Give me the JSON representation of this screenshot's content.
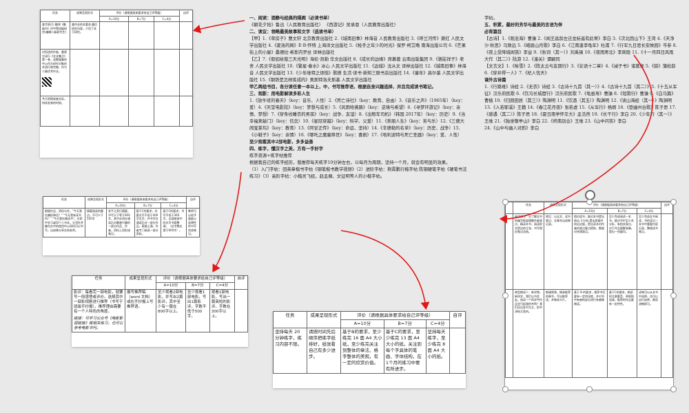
{
  "rubric_small": {
    "h_task": "任务",
    "h_form": "成果呈现形式",
    "h_eval": "评价（请根据具体要求给自己评等级）",
    "h_a": "A=10分",
    "h_b": "B=7分",
    "h_c": "C=4分",
    "h_self": "自评",
    "rows": [
      [
        "查字纸(1) 翻译《剿敌书》评中等班级研究(编辑二级研究生)",
        "查作业的本要求,最后研究内容，介绍了关于研究。"
      ],
      [
        "对所选的作者、重视它读行《文化集注》第一卷，读数据集的中心作为研究对象的并进行和完善，作为二级优秀作业。"
      ],
      [
        "共大地理或者交际，持续发育的时刻。"
      ]
    ]
  },
  "rubric_mid": {
    "h_task": "任务",
    "h_form": "成果呈现形式",
    "h_eval": "评价（请根据具体要求给自己评等级）",
    "h_a": "A=10分",
    "h_b": "B=7分",
    "h_c": "C=4分",
    "h_self": "自评",
    "task": "根据作品、资料与作，\"今天我在编织神话？\" \"今天我有读书吗？\" \"今天我在精读书\"，在家中学习或用个人书本，头顶在并编号在中的使用中心同时可以书写。出成果分享交给老师。",
    "form": "摘要阅读的重点，不可少于500字",
    "a": "发手之家行摘要，书写大于等于600字，其中必须在诵读后对最感兴趣的一部分作品、作者，资料上用形成笔记。",
    "b": "基于C的要求，对要点写不低于400字文字，并书写在诵读后对一部分作品，表格之诵，作者专门阅读一部分资料。",
    "c": "基于C的要求，书写不低于300字，全部按说中的文字书面整理，（总字数应提于600字）。",
    "self": "教师可以给予鼓励以选择性的书写完成笔记。"
  },
  "rubric_left": {
    "h_task": "任务",
    "h_form": "成果呈现形式",
    "h_eval": "评价（请根据具体要求给自己评等级）",
    "h_a": "A=10分",
    "h_b": "B=7分",
    "h_c": "C=4分",
    "h_self": "自评",
    "task": "影评：每看完一部电影，就要写一段感悟或评价。选择其中一部影视剧进行推荐（书写于班级手抄报），推荐理由需要有一个人特色的角度。",
    "task2": "链接：可学习公众号《电影影视链接》做相关练习，也可以参考电影书刊。",
    "form": "撰写推荐稿（word 文档）或在手抄报上写推荐语。",
    "a": "至少观看2部电影，并写出2篇影评，其中至少有一篇在800字以上。",
    "b": "至少观看1部电影，写出1篇影评，字数不低于500字。",
    "c": "观看1部电影，写出一篇简短的影评，字数在300字以上。"
  },
  "rubric_bottom": {
    "h_task": "任务",
    "h_form": "成果呈现形式",
    "h_eval": "评价（请根据具体要求给自己评等级）",
    "h_a": "A=10分",
    "h_b": "B=7分",
    "h_c": "C=4分",
    "h_self": "自评",
    "task": "坚持每天 20 分钟练字，练习内容不限。",
    "form": "请按时间先后顺序把练字纸排好，纸张看自己有多少进步。",
    "a": "基于B的要求，至少练完 16 面 A4 大小纸，至少练完关注到整体的章法、格字整体的美观，有一定的欣赏价值。",
    "b": "基于C的要求，至少练完 13 面 A4 大小的纸，关注到每个字具体的笔画、字体结构，在1个月的练习中要有所进步。",
    "c": "坚持每天练字，至少练完 8 面 A4 大小的纸。"
  },
  "rubric_right": {
    "h_task": "任务",
    "h_form": "成果呈现形式",
    "h_eval": "评价（请根据具体要求给自己评等级）",
    "h_a": "A=10分",
    "h_b": "B=7分",
    "h_c": "C=4分",
    "h_self": "自评",
    "r1_task": "阅读前作：对了解全书的编写框架理解作者观点，精读本书，阅读前文提出的主张，书写相应笔记总结。",
    "r1_form": "除后：以论文、读书笔记、文章合出成果记录。",
    "r1_a": "相对读书，能对本书提出结论,于分析,提出质疑并给出论据，提出读本对作者的观点要点提炼，数据对合理观点。",
    "r1_b": "至少完成阅读一本书，能对书中至少合分析，有相关观点，对于作品理解准确，提出一些疑问。",
    "r1_c": "至少完成全书阅读，书的读记一本书中重要内容记录，整理读书笔记。",
    "r2_task": "典型朗读人：新学期，新同学，我们以书会友。阅读一个同学中作品会引起我的共鸣？我们应出发书为主，把书讲给大家听。",
    "r2_form": "朗诵视频，摘录推荐的章节，写出推荐语，并做成卡片。",
    "r2_a": "基于 B 的要求，推荐书目要有一定的深度，并对书中有感的部分进行有感情朗读。",
    "r2_b": "基于C的要求，朗读时注意重音、停顿和语调，推荐的作品要有一定特色。",
    "r2_c": "读物可以从本书中选择，也可以自行选择，朗读流畅即可。"
  },
  "doc_center": {
    "s1": "一、阅读：酒静与经典的隔阂（必读书单）",
    "s1a": "《朝花夕拾》鲁迅（人民教育出版社） 《西游记》吴承恩（人民教育出版社）",
    "s2": "二、读议：领略最美故事和文字（选读书单）",
    "s2a": "【甲】1.《草房子》曹文轩 北京教育出版社 2.《城南旧事》林海音 人民教育出版社 3.《呼兰河传》萧红 人民文学出版社 4.《夏洛的网》E·B·怀特 上海译文出版社 5.《枪手之年少的时光》保罗·柯艾略 南海出版公司 6.《芒果街上的小屋》桑德拉·希斯内罗丝 译林出版社",
    "s2b": "【乙】7.《假如给我三天光明》海伦·凯勒 华文出版社 8.《成长的边缘》席慕蓉 云南出版集团 9.《骆驼祥子》老舍 人民文学出版社 10.《繁星·春水》冰心 人民文学出版社 11.《边城》沈从文 译林出版社 12.《城南旧事》林海音 人民文学出版社 13.《少年维特之烦恼》歌德 生活·读书·新知三联书店出版社 14.《童年》高尔基 人民文学出版社 15.《钢铁是怎样炼成的》奥斯特洛夫斯基 人民文学出版社",
    "s2c": "甲乙两组书目，各分读任意一本以上，中，书写推荐语，根据自身兴趣选择，并且完成读书笔记。",
    "s3": "三、观影：用电影解读多彩人生",
    "s3a": "1.《放牛班的春天》（key：音乐、人性）2.《死亡诗社》（key：教育、自由）3.《音乐之声》（1965年）（key：爱）4.《天堂电影院》（key：梦想与成长）5.《风雨哈佛路》（key：逆境与希望）6.《寻梦环游记》（key：亲情、梦想）7.《穿条纹睡衣的男孩》（key：战争、友谊）8.《出租车司机》（韩国 2017年）（key：历史）9.《当幸福来敲门》（key：信念）10.《星际穿越》（key：科学、父爱）11.《美丽人生》（key：苦与乐）12.《三傻大闹宝莱坞》（key：教育）13.《阿甘正传》（key：命运、坚持）14.《辛德勒的名单》（key：历史、战争）15.《小鞋子》（key：亲情）16.《哪吒之魔童降世》（key：喜剧）17.《哈利波特与死亡圣器》（key：爱、人性）",
    "s3b": "至少观看其中2部电影，多多益善",
    "s4": "四、练字，懂汉字之美，方有一手好字",
    "s4a": "练字资源+练字帖推荐",
    "s4b": "根据我自己的练字经历，我推荐每天练字10分钟左右，以每月为周期，坚持一个月，就会有明显的效果。",
    "s4c": "（1）入门字帖：田英章楷书字帖《钢笔楷书教学视频》（2）进阶字帖：荆霄鹏行楷字帖 陈钢硬笔字帖《硬笔书法练习》（3）高阶字帖：小楷灵飞经，赵孟頫、文征明等人的小楷字帖。"
  },
  "doc_right": {
    "top": "字帖。",
    "s5": "五、积累，最好的芳华与最美的言语为伴",
    "h1": "必背篇目",
    "p1": "【古诗】1.《观沧海》曹操 2.《闻王昌龄左迁龙标遥有此寄》李白 3.《次北固山下》王湾 4.《天净沙·秋思》马致远 5.《峨眉山月歌》李白 6.《江南逢李龟年》杜甫 7.《行军九日思长安故园》岑参 8.《夜上受降城闻笛》李益 9.《秋词（其一）》刘禹锡 10.《夜雨寄北》李商隐 11.《十一月四日风雨大作（其二）》陆游 12.《潼关》谭嗣同",
    "p2": "【文言文】1.《咏雪》2.《陈太丘与友期行》3.《论语十二章》4.《诫子书》诸葛亮 5.《狼》蒲松龄 6.《穿井得一人》7.《杞人忧天》",
    "h2": "课外古诗篇",
    "p3": "1.《行路难》诗经 2.《无衣》诗经 3.《古诗十九首（其一）》4.《古诗十九首（其二）》5.《十五从军征》汉乐府民歌 6.《饮马长城窟行》汉乐府民歌 7.《龟虽寿》曹操 8.《短歌行》曹操 9.《白马篇》曹植 10.《归园田居（其三）》陶渊明 11.《饮酒（其五）》陶渊明 12.《读山海经（其一）》陶渊明 13.《入若耶溪》王籍 14.《春江花月夜》张若虚 15.《从军行》杨炯 16.《登幽州台歌》陈子昂 17.《感遇（其二）》陈子昂 18.《夏日南亭怀辛大》孟浩然 19.《长干行》李白 20.《少年行（其一）》王维 21.《独坐敬亭山》李白 22.《终南别业》王维 23.《山中问答》李白",
    "tail": "24.《山中与幽人对酌》李白"
  }
}
